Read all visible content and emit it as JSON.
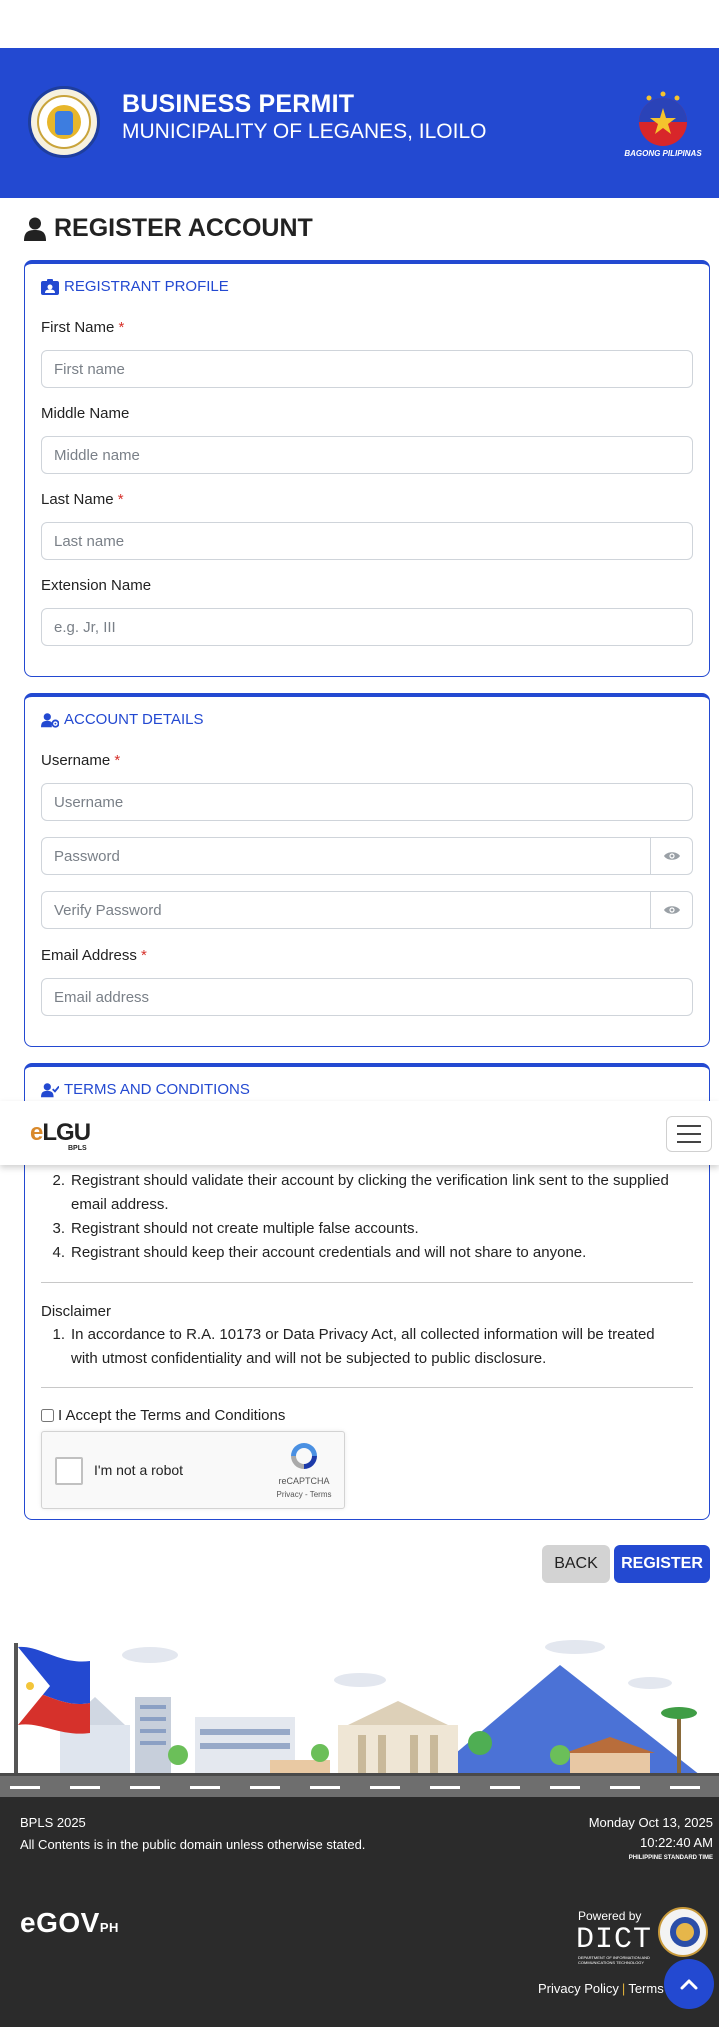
{
  "header": {
    "title": "BUSINESS PERMIT",
    "subtitle": "MUNICIPALITY OF LEGANES, ILOILO",
    "seal_icon": "municipal-seal-icon",
    "right_logo": "bagong-pilipinas-logo",
    "right_logo_label": "BAGONG PILIPINAS"
  },
  "page": {
    "title": "REGISTER ACCOUNT"
  },
  "profile": {
    "heading": "REGISTRANT PROFILE",
    "first_label": "First Name",
    "first_placeholder": "First name",
    "middle_label": "Middle Name",
    "middle_placeholder": "Middle name",
    "last_label": "Last Name",
    "last_placeholder": "Last name",
    "ext_label": "Extension Name",
    "ext_placeholder": "e.g. Jr, III"
  },
  "account": {
    "heading": "ACCOUNT DETAILS",
    "username_label": "Username",
    "username_placeholder": "Username",
    "password_placeholder": "Password",
    "verify_placeholder": "Verify Password",
    "email_label": "Email Address",
    "email_placeholder": "Email address"
  },
  "terms": {
    "heading": "TERMS AND CONDITIONS",
    "items": [
      {
        "num": "2.",
        "text": "Registrant should validate their account by clicking the verification link sent to the supplied email address."
      },
      {
        "num": "3.",
        "text": "Registrant should not create multiple false accounts."
      },
      {
        "num": "4.",
        "text": "Registrant should keep their account credentials and will not share to anyone."
      }
    ],
    "disclaimer_title": "Disclaimer",
    "disclaimer_items": [
      {
        "num": "1.",
        "text": "In accordance to R.A. 10173 or Data Privacy Act, all collected information will be treated with utmost confidentiality and will not be subjected to public disclosure."
      }
    ],
    "accept_label": "I Accept the Terms and Conditions",
    "accepted": false
  },
  "captcha": {
    "label": "I'm not a robot",
    "brand": "reCAPTCHA",
    "links": "Privacy - Terms"
  },
  "actions": {
    "back": "BACK",
    "register": "REGISTER"
  },
  "navbar": {
    "brand": "eLGU",
    "brand_sub": "BPLS"
  },
  "footer": {
    "line1": "BPLS 2025",
    "line2": "All Contents is in the public domain unless otherwise stated.",
    "date": "Monday Oct 13, 2025",
    "time": "10:22:40 AM",
    "tz": "PHILIPPINE STANDARD TIME",
    "egov": "eGOV",
    "egov_suffix": "PH",
    "powered_by": "Powered by",
    "dict": "DICT",
    "dict_sub": "DEPARTMENT OF INFORMATION AND COMMUNICATIONS TECHNOLOGY",
    "privacy": "Privacy Policy",
    "terms": "Terms"
  },
  "colors": {
    "primary": "#2349d1",
    "required": "#d6312b",
    "footer_bg": "#2b2b2b"
  }
}
